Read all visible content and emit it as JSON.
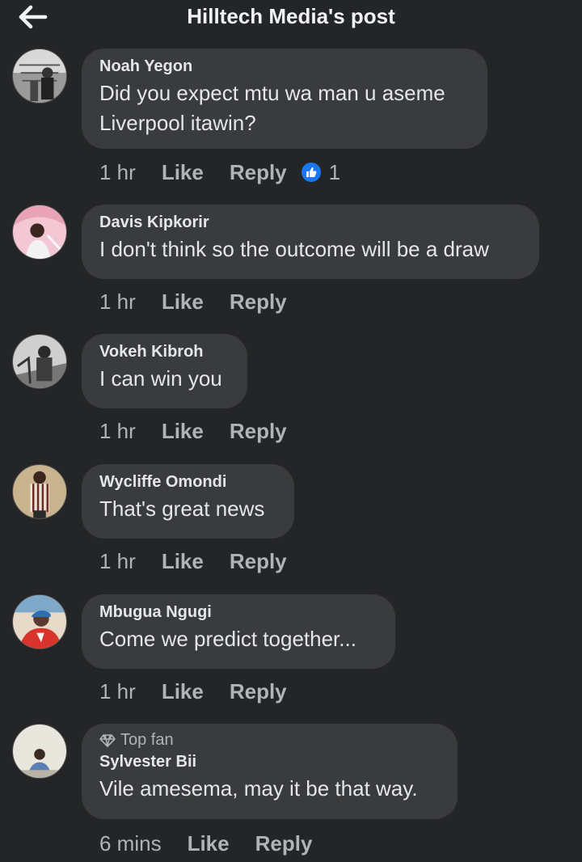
{
  "header": {
    "title": "Hilltech Media's post"
  },
  "comments": [
    {
      "name": "Noah Yegon",
      "text_lines": [
        "Did you expect mtu wa man u aseme",
        "Liverpool itawin?"
      ],
      "time": "1 hr",
      "like_label": "Like",
      "reply_label": "Reply",
      "reaction_count": "1"
    },
    {
      "name": "Davis Kipkorir",
      "text_lines": [
        "I don't think so the outcome will be a draw"
      ],
      "time": "1 hr",
      "like_label": "Like",
      "reply_label": "Reply"
    },
    {
      "name": "Vokeh Kibroh",
      "text_lines": [
        "I can win you"
      ],
      "time": "1 hr",
      "like_label": "Like",
      "reply_label": "Reply"
    },
    {
      "name": "Wycliffe Omondi",
      "text_lines": [
        "That's great news"
      ],
      "time": "1 hr",
      "like_label": "Like",
      "reply_label": "Reply"
    },
    {
      "name": "Mbugua Ngugi",
      "text_lines": [
        "Come we predict together..."
      ],
      "time": "1 hr",
      "like_label": "Like",
      "reply_label": "Reply"
    },
    {
      "badge": "Top fan",
      "name": "Sylvester Bii",
      "text_lines": [
        "Vile amesema, may it be that way."
      ],
      "time": "6 mins",
      "like_label": "Like",
      "reply_label": "Reply"
    }
  ],
  "colors": {
    "background": "#242527",
    "bubble": "#3a3b3c",
    "muted_text": "#b0b3b8",
    "like_blue": "#1877f2"
  }
}
